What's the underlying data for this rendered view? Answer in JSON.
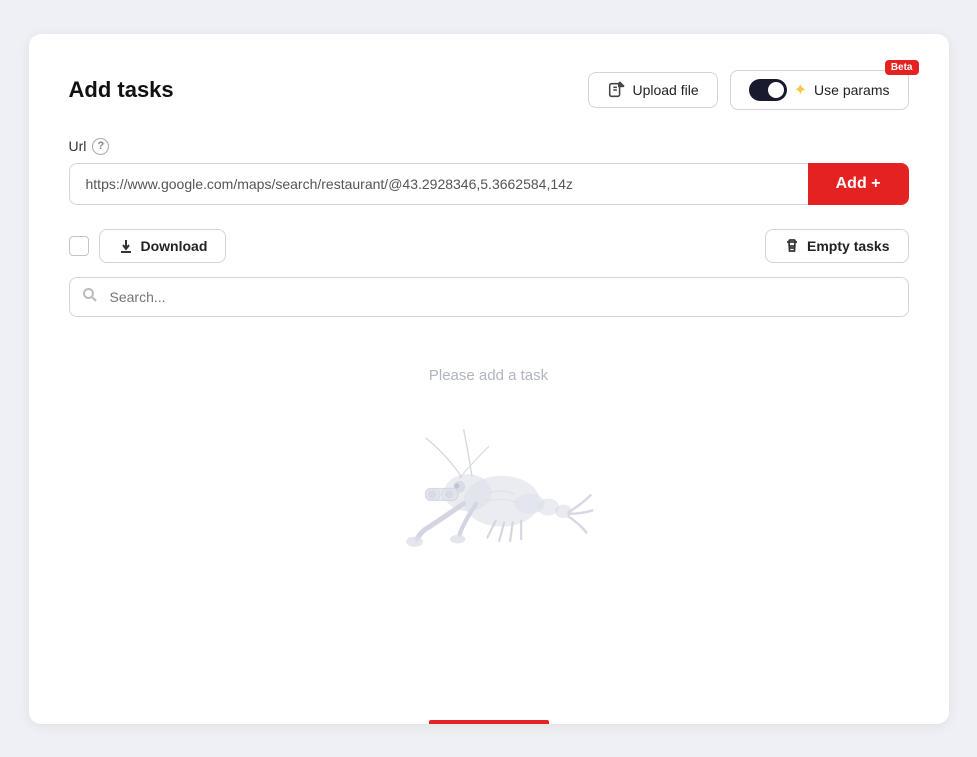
{
  "page": {
    "title": "Add tasks",
    "header": {
      "upload_label": "Upload file",
      "use_params_label": "Use params",
      "beta_badge": "Beta"
    },
    "url_section": {
      "label": "Url",
      "placeholder": "https://www.google.com/maps/search/restaurant/@43.2928346,5.3662584,14z",
      "add_button": "Add +"
    },
    "toolbar": {
      "download_label": "Download",
      "empty_tasks_label": "Empty tasks"
    },
    "search": {
      "placeholder": "Search..."
    },
    "empty_state": {
      "message": "Please add a task"
    }
  }
}
